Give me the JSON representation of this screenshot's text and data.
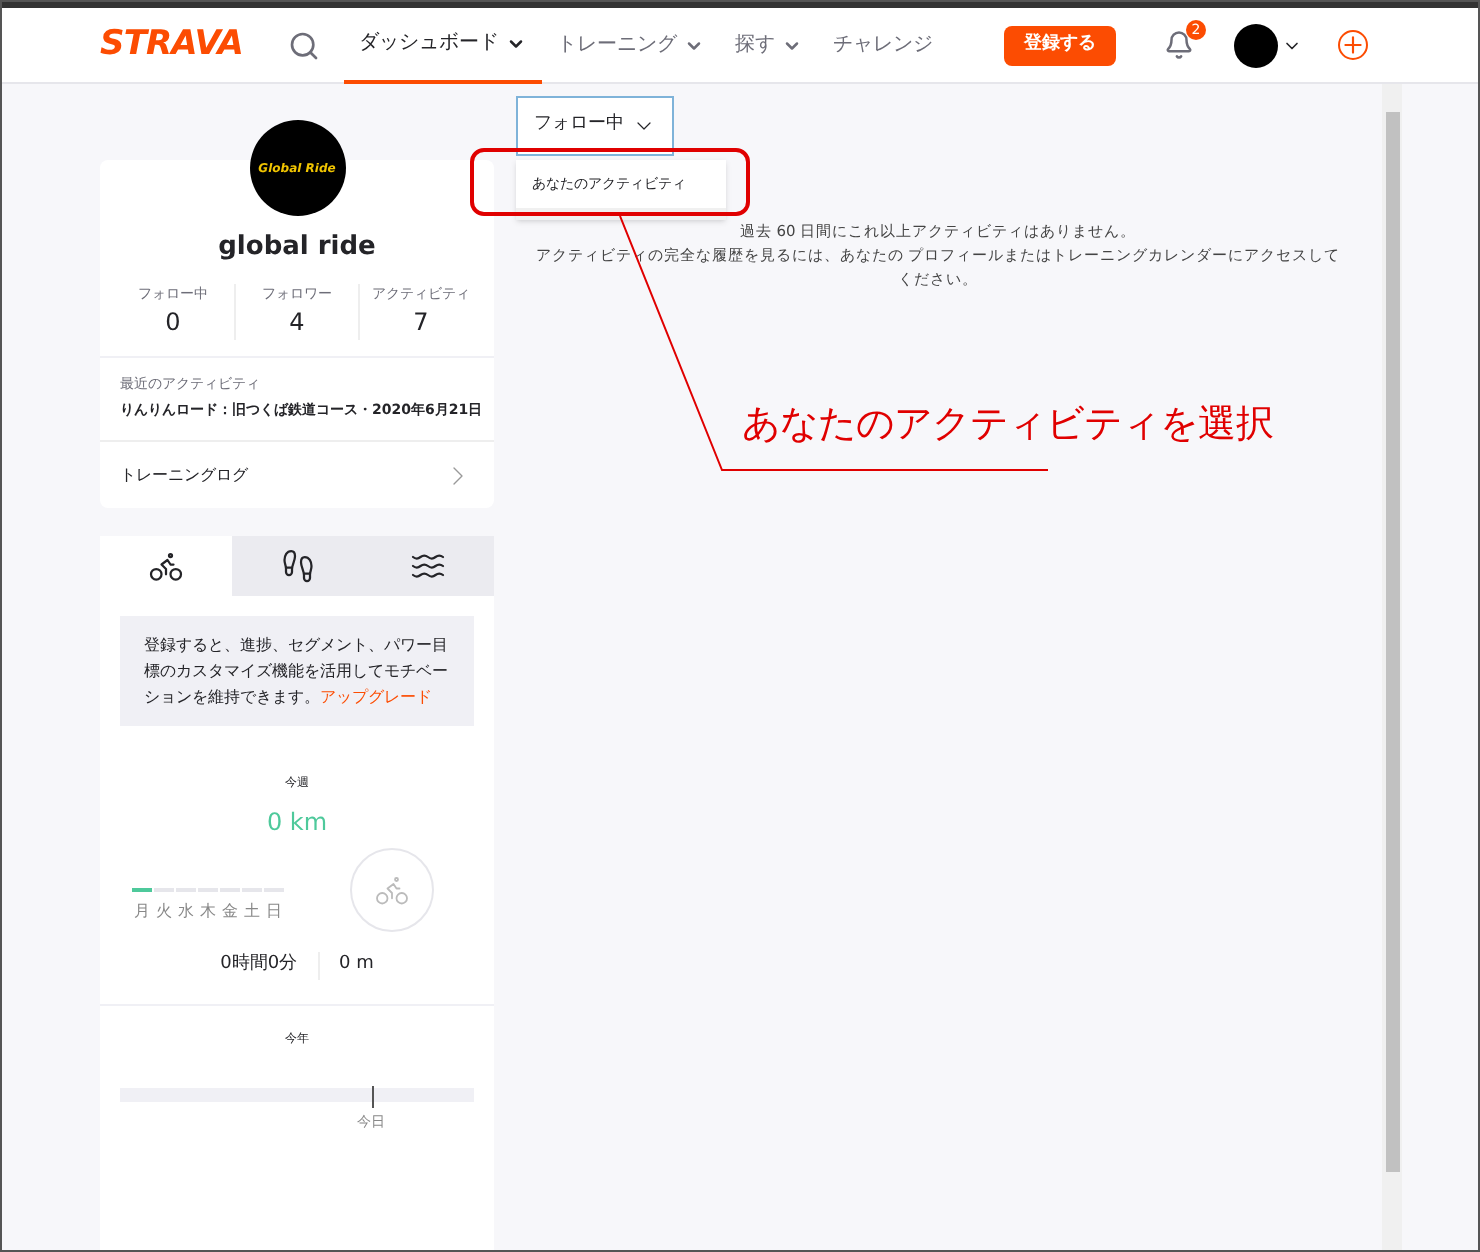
{
  "nav": {
    "logo": "STRAVA",
    "items": [
      {
        "label": "ダッシュボード",
        "selected": true
      },
      {
        "label": "トレーニング",
        "selected": false,
        "caret": true
      },
      {
        "label": "探す",
        "selected": false,
        "caret": true
      },
      {
        "label": "チャレンジ",
        "selected": false,
        "caret": false
      }
    ],
    "signup": "登録する",
    "notifications": "2"
  },
  "profile": {
    "name": "global ride",
    "avatar_text": "Global Ride",
    "stats": [
      {
        "label": "フォロー中",
        "value": "0"
      },
      {
        "label": "フォロワー",
        "value": "4"
      },
      {
        "label": "アクティビティ",
        "value": "7"
      }
    ],
    "recent_label": "最近のアクティビティ",
    "recent": "りんりんロード：旧つくば鉄道コース・2020年6月21日",
    "training_log": "トレーニングログ"
  },
  "sport_tabs": [
    {
      "kind": "bike",
      "selected": true
    },
    {
      "kind": "run",
      "selected": false
    },
    {
      "kind": "swim",
      "selected": false
    }
  ],
  "upsell": {
    "text": "登録すると、進捗、セグメント、パワー目標のカスタマイズ機能を活用してモチベーションを維持できます。",
    "link": "アップグレード"
  },
  "week": {
    "title": "今週",
    "distance": "0 km",
    "days": [
      {
        "label": "月",
        "selected": true
      },
      {
        "label": "火",
        "selected": false
      },
      {
        "label": "水",
        "selected": false
      },
      {
        "label": "木",
        "selected": false
      },
      {
        "label": "金",
        "selected": false
      },
      {
        "label": "土",
        "selected": false
      },
      {
        "label": "日",
        "selected": false
      }
    ],
    "time": "0時間0分",
    "elevation": "0 m"
  },
  "year": {
    "title": "今年",
    "today_label": "今日",
    "level": 0.71
  },
  "feed_filter": {
    "value": "フォロー中",
    "options": [
      "あなたのアクティビティ"
    ]
  },
  "empty_message": [
    "過去 60 日間にこれ以上アクティビティはありません。",
    "アクティビティの完全な履歴を見るには、あなたの プロフィールまたはトレーニングカレンダーにアクセスしてください。"
  ],
  "annotation": "あなたのアクティビティを選択"
}
